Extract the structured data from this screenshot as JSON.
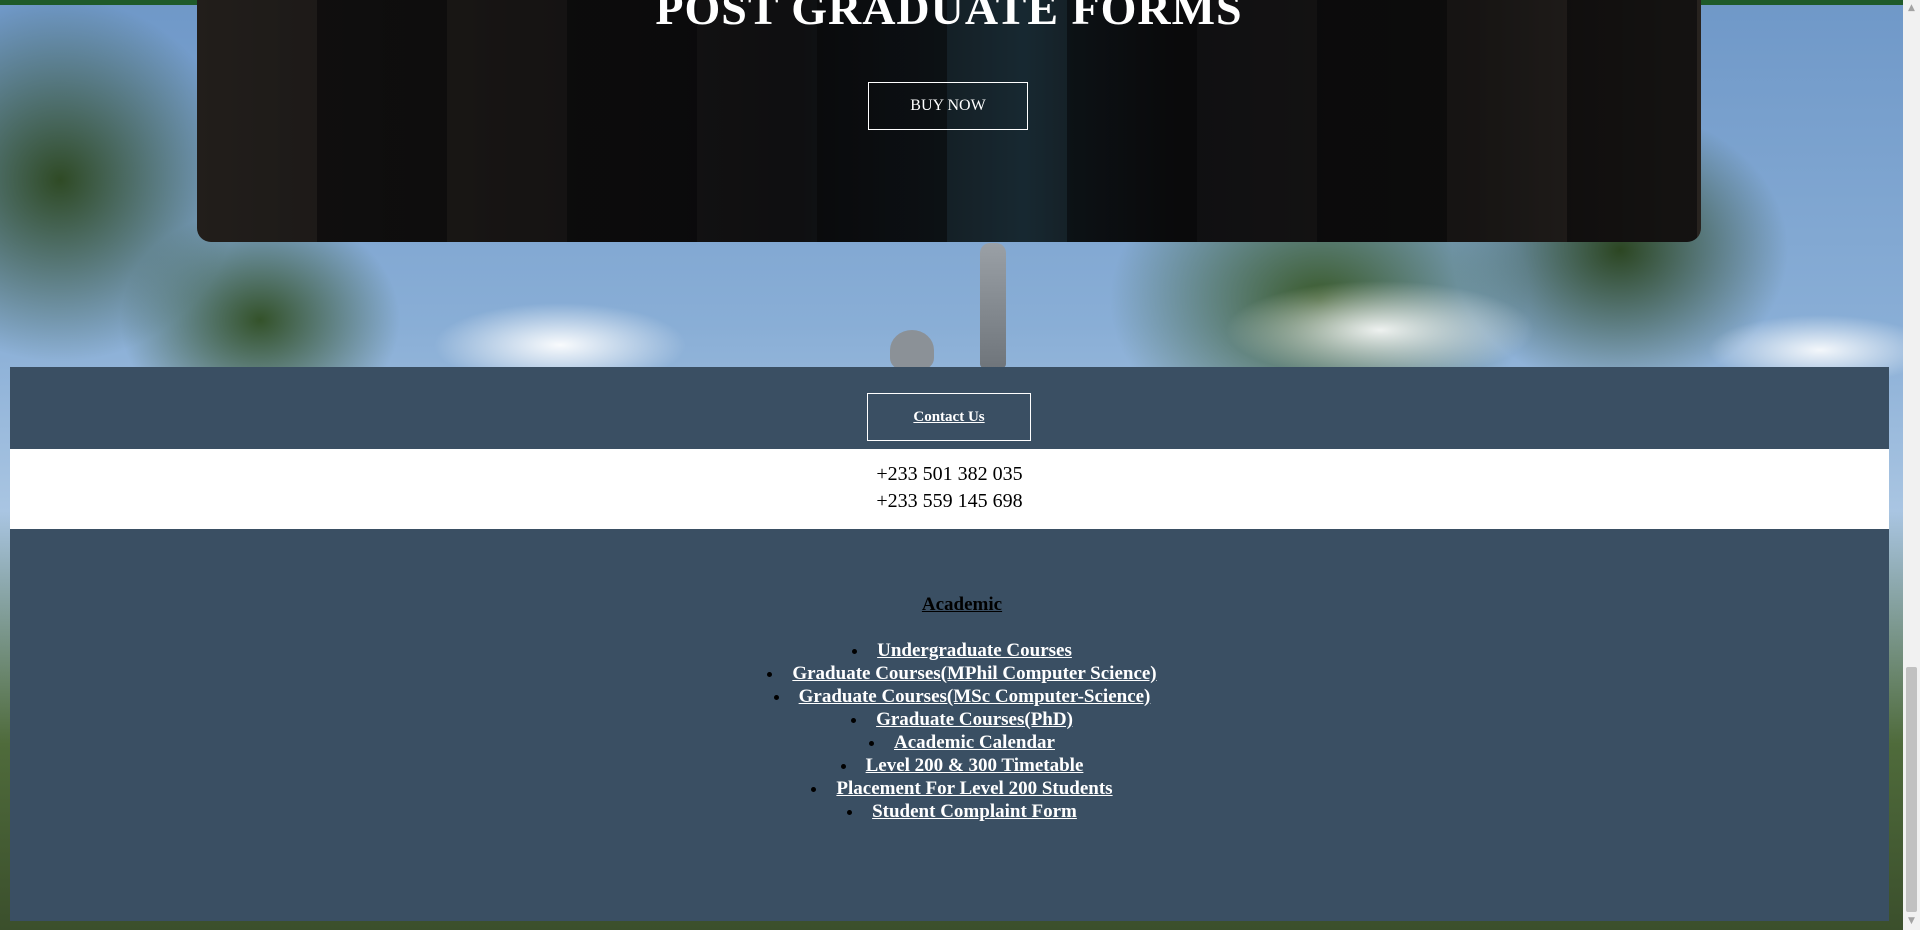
{
  "hero": {
    "title": "POST GRADUATE FORMS",
    "buy_now_label": "BUY NOW"
  },
  "contact": {
    "button_label": "Contact Us",
    "phones": [
      "+233 501 382 035",
      "+233 559 145 698"
    ]
  },
  "academic": {
    "heading": "Academic",
    "links": [
      "Undergraduate Courses",
      "Graduate Courses(MPhil Computer Science)",
      "Graduate Courses(MSc Computer-Science)",
      "Graduate Courses(PhD)",
      "Academic Calendar",
      "Level 200 & 300 Timetable",
      "Placement For Level 200 Students",
      "Student Complaint Form"
    ]
  },
  "colors": {
    "footer_bg": "#3a4f63",
    "top_bar": "#1f5a2a"
  },
  "scrollbar": {
    "up_icon": "triangle-up-icon",
    "down_icon": "triangle-down-icon"
  }
}
